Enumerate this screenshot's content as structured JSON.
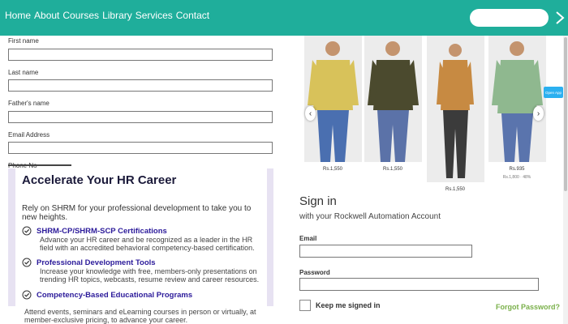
{
  "nav": {
    "links": [
      "Home",
      "About",
      "Courses",
      "Library",
      "Services",
      "Contact"
    ],
    "search_placeholder": ""
  },
  "form": {
    "fields": [
      {
        "label": "First name",
        "value": ""
      },
      {
        "label": "Last name",
        "value": ""
      },
      {
        "label": "Father's name",
        "value": ""
      },
      {
        "label": "Email Address",
        "value": ""
      },
      {
        "label": "Phone No",
        "value": ""
      }
    ]
  },
  "hr_card": {
    "title": "Accelerate Your HR Career",
    "subtitle": "Rely on SHRM for your professional development to take you to new heights.",
    "items": [
      {
        "heading": "SHRM-CP/SHRM-SCP Certifications",
        "description": "Advance your HR career and be recognized as a leader in the HR field with an accredited behavioral competency-based certification."
      },
      {
        "heading": "Professional Development Tools",
        "description": "Increase your knowledge with free, members-only presentations on trending HR topics, webcasts, resume review and career resources."
      },
      {
        "heading": "Competency-Based Educational Programs",
        "description": "Attend events, seminars and eLearning courses in person or virtually, at member-exclusive pricing, to advance your career."
      }
    ]
  },
  "carousel": {
    "products": [
      {
        "price": "Rs.1,550",
        "sale": "",
        "shirt_color": "#d8c25a",
        "pants_color": "#4a6fb0"
      },
      {
        "price": "Rs.1,550",
        "sale": "",
        "shirt_color": "#4b4a2e",
        "pants_color": "#5b72a8"
      },
      {
        "price": "Rs.1,550",
        "sale": "",
        "shirt_color": "#c78a42",
        "pants_color": "#3b3b3b"
      },
      {
        "price": "Rs.935",
        "sale": "Rs.1,800 · 48%",
        "shirt_color": "#8fb88f",
        "pants_color": "#5a74ad"
      }
    ],
    "prev_icon": "‹",
    "next_icon": "›",
    "side_tab": "Open App"
  },
  "signin": {
    "title": "Sign in",
    "subtitle": "with your Rockwell Automation Account",
    "email_label": "Email",
    "password_label": "Password",
    "keep_label": "Keep me signed in",
    "forgot_label": "Forgot Password?"
  },
  "colors": {
    "nav_bg": "#1fae9b",
    "forgot": "#7ab04a",
    "hr_accent": "#2b1a9a"
  }
}
